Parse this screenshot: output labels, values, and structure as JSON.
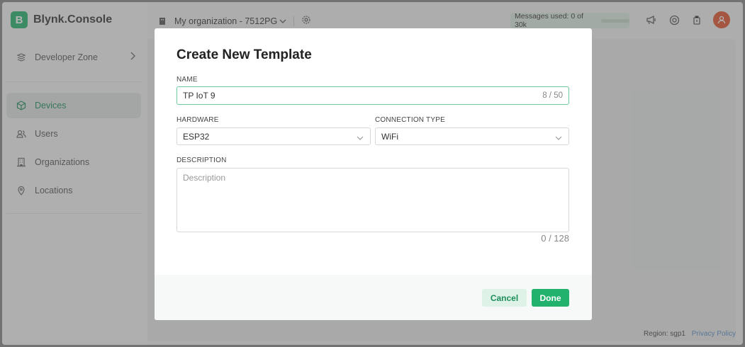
{
  "brand": {
    "logo_letter": "B",
    "name": "Blynk.Console"
  },
  "sidebar": {
    "developer_zone": "Developer Zone",
    "items": [
      {
        "label": "Devices",
        "icon": "cube-icon",
        "active": true
      },
      {
        "label": "Users",
        "icon": "users-icon"
      },
      {
        "label": "Organizations",
        "icon": "building-icon"
      },
      {
        "label": "Locations",
        "icon": "location-pin-icon"
      }
    ]
  },
  "header": {
    "org_name": "My organization - 7512PG",
    "messages": "Messages used: 0 of 30k"
  },
  "footer": {
    "region": "Region: sgp1",
    "privacy": "Privacy Policy"
  },
  "modal": {
    "title": "Create New Template",
    "name_label": "NAME",
    "name_value": "TP IoT 9",
    "name_counter": "8 / 50",
    "hardware_label": "HARDWARE",
    "hardware_value": "ESP32",
    "connection_label": "CONNECTION TYPE",
    "connection_value": "WiFi",
    "description_label": "DESCRIPTION",
    "description_placeholder": "Description",
    "description_counter": "0 / 128",
    "cancel": "Cancel",
    "done": "Done"
  },
  "colors": {
    "accent": "#23b26d",
    "accent_dark": "#1c8f5a",
    "avatar": "#e0522a"
  }
}
